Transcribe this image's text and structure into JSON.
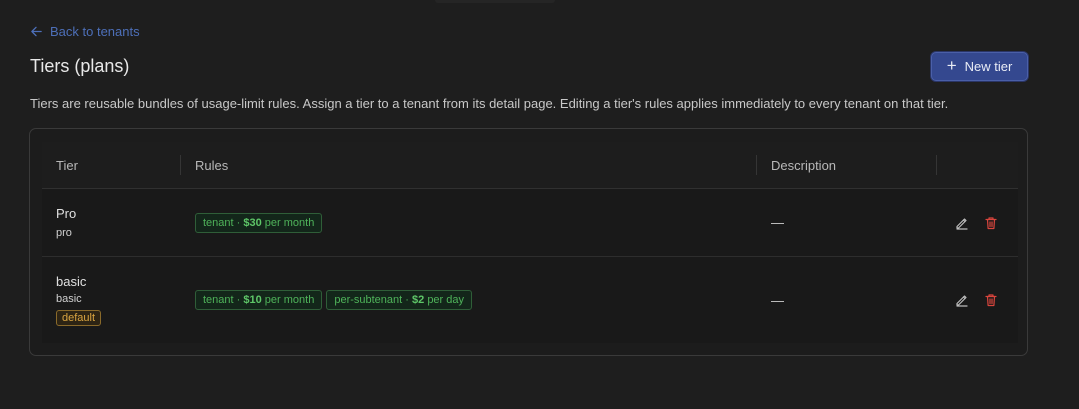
{
  "nav": {
    "back_label": "Back to tenants"
  },
  "header": {
    "title": "Tiers (plans)",
    "new_button_label": "New tier"
  },
  "description": "Tiers are reusable bundles of usage-limit rules. Assign a tier to a tenant from its detail page. Editing a tier's rules applies immediately to every tenant on that tier.",
  "table": {
    "columns": [
      "Tier",
      "Rules",
      "Description",
      ""
    ],
    "rows": [
      {
        "name": "Pro",
        "slug": "pro",
        "default_badge": "",
        "rules": [
          {
            "scope": "tenant",
            "amount": "$30",
            "period": "per month"
          }
        ],
        "description": "—"
      },
      {
        "name": "basic",
        "slug": "basic",
        "default_badge": "default",
        "rules": [
          {
            "scope": "tenant",
            "amount": "$10",
            "period": "per month"
          },
          {
            "scope": "per-subtenant",
            "amount": "$2",
            "period": "per day"
          }
        ],
        "description": "—"
      }
    ]
  },
  "colors": {
    "accent": "#34488f",
    "link": "#4d6fb8",
    "rule_green": "#4fb35a",
    "default_badge": "#d9a441",
    "delete_red": "#d9453d"
  },
  "icons": {
    "back": "arrow-left-icon",
    "add": "plus-icon",
    "edit": "pencil-icon",
    "delete": "trash-icon"
  }
}
